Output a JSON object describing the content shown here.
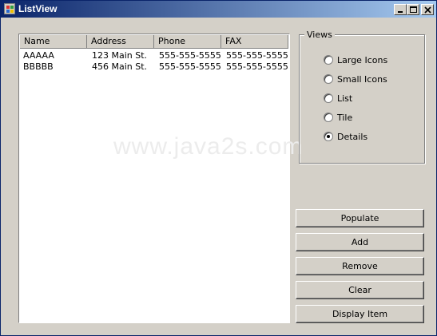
{
  "window": {
    "title": "ListView"
  },
  "listview": {
    "columns": [
      "Name",
      "Address",
      "Phone",
      "FAX"
    ],
    "rows": [
      {
        "name": "AAAAA",
        "address": "123 Main St.",
        "phone": "555-555-5555",
        "fax": "555-555-5555"
      },
      {
        "name": "BBBBB",
        "address": "456 Main St.",
        "phone": "555-555-5555",
        "fax": "555-555-5555"
      }
    ]
  },
  "views": {
    "label": "Views",
    "options": [
      "Large Icons",
      "Small Icons",
      "List",
      "Tile",
      "Details"
    ],
    "selected": "Details"
  },
  "buttons": {
    "populate": "Populate",
    "add": "Add",
    "remove": "Remove",
    "clear": "Clear",
    "display_item": "Display Item"
  },
  "watermark": "www.java2s.com"
}
